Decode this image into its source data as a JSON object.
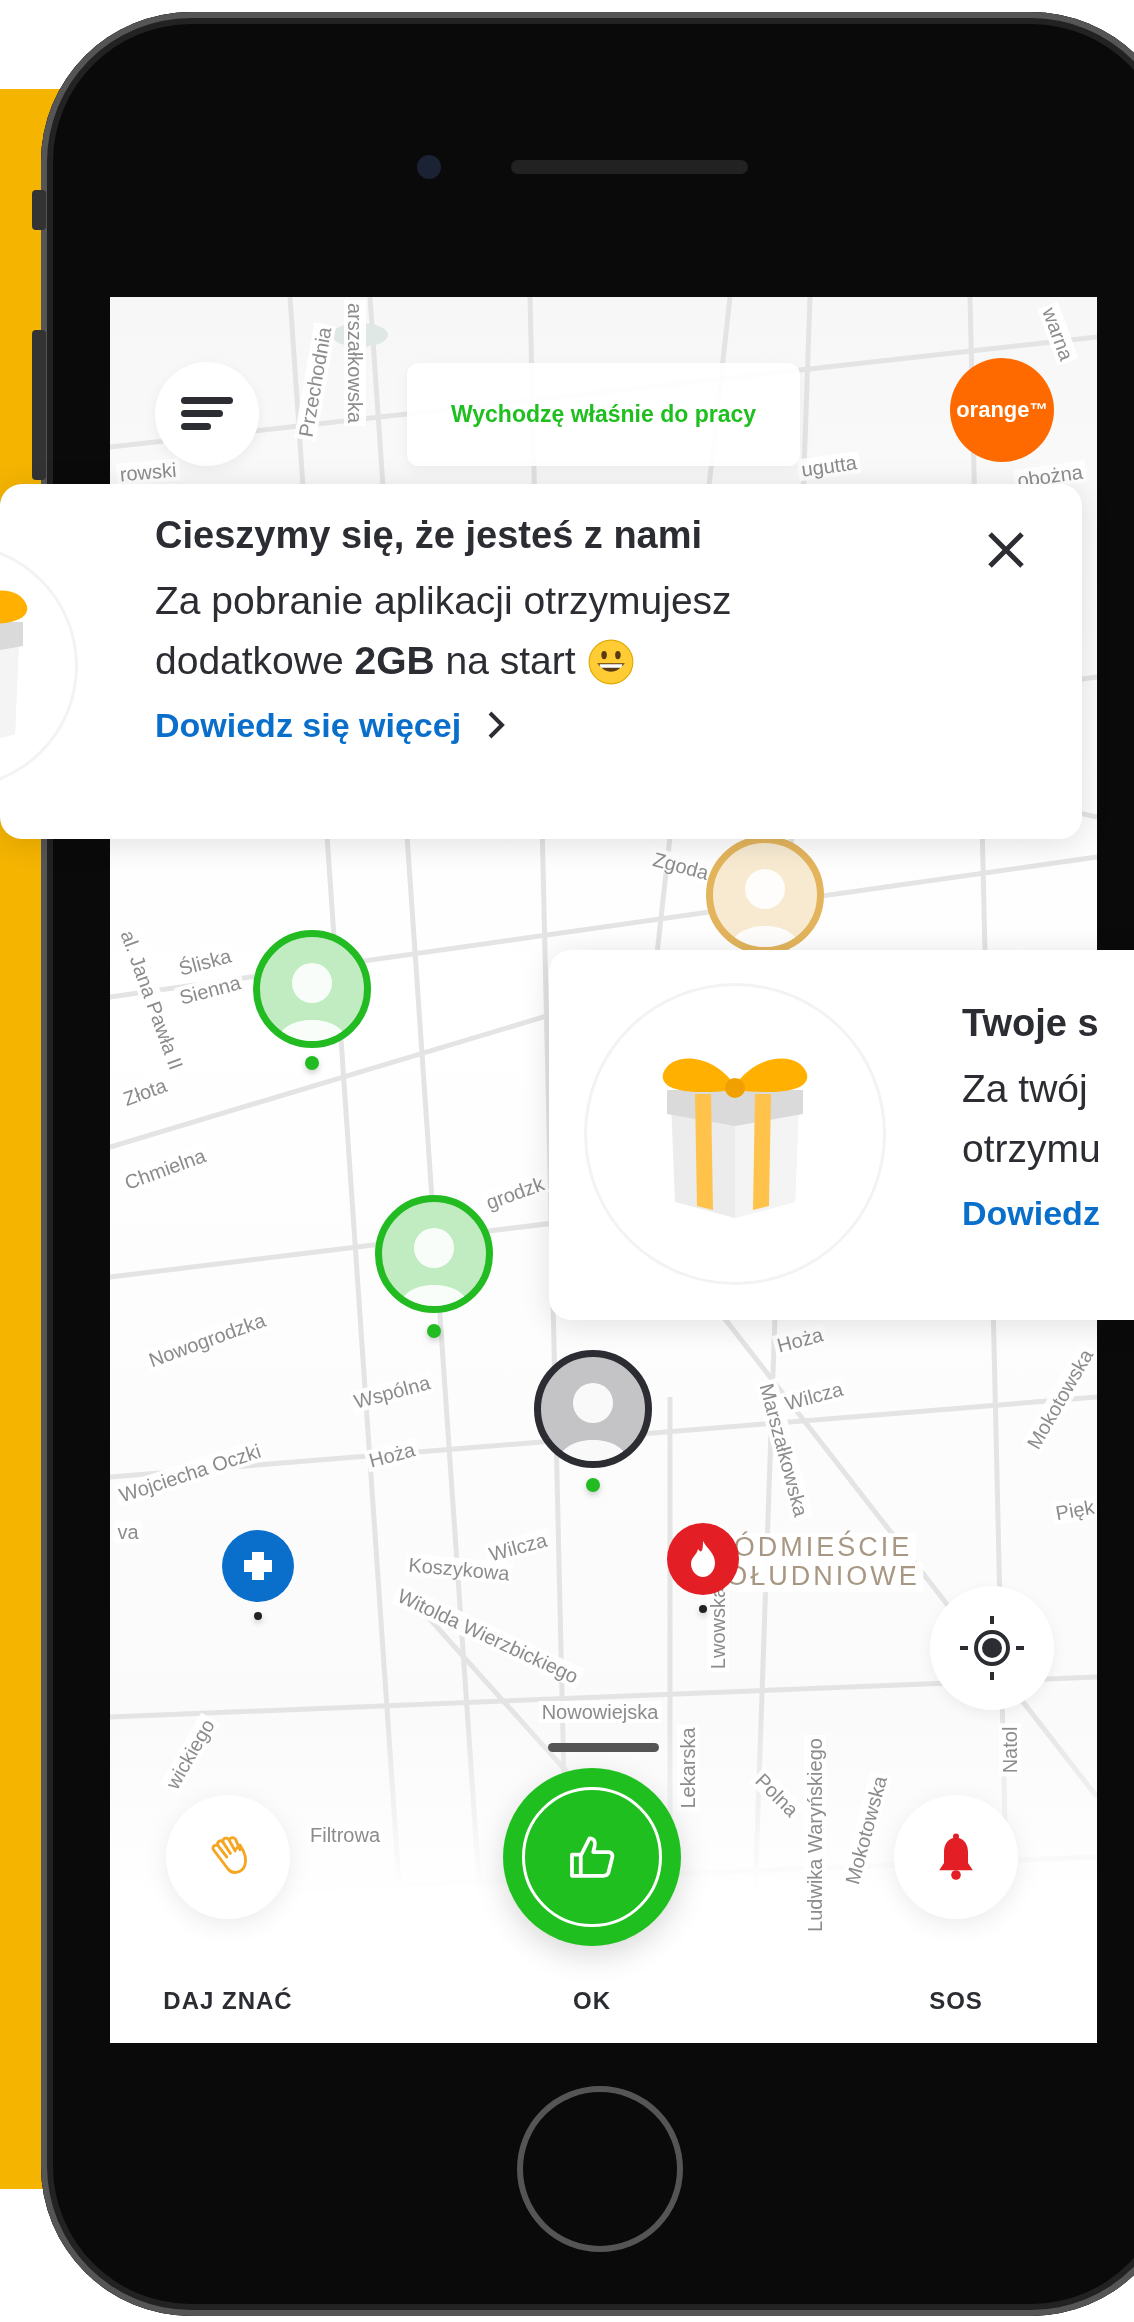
{
  "top_bar": {
    "status": "Wychodzę właśnie do pracy",
    "brand": "orange",
    "brand_mark": "™"
  },
  "cards": [
    {
      "title": "Cieszymy się, że jesteś z nami",
      "body": [
        "Za pobranie aplikacji otrzymujesz",
        "dodatkowe **2GB** na start"
      ],
      "emoji": true,
      "link": "Dowiedz się więcej",
      "closable": true
    },
    {
      "title": "Twoje s",
      "body": [
        "Za twój",
        "otrzymu"
      ],
      "emoji": false,
      "link": "Dowiedz",
      "closable": false
    }
  ],
  "map": {
    "labels": [
      "Przechodnia",
      "arszałkowska",
      "rowski",
      "warna",
      "ugutta",
      "obożna",
      "Zgoda",
      "Śliska",
      "Sienna",
      "al. Jana Pawła II",
      "Złota",
      "Chmielna",
      "Nowogrodzka",
      "grodzk",
      "Wspólna",
      "Wojciecha Oczki",
      "Hoża",
      "Hoża",
      "Wilcza",
      "Wilcza",
      "Koszykowa",
      "Witolda Wierzbickiego",
      "Lwowska",
      "Marszałkowska",
      "Mokotowska",
      "Pięk",
      "ÓDMIEŚCIE",
      "OŁUDNIOWE",
      "Nowowiejska",
      "Lekarska",
      "Filtrowa",
      "wickiego",
      "Polna",
      "Ludwika Waryńskiego",
      "Mokotowska",
      "Natol",
      "va"
    ],
    "avatars": [
      {
        "color": "#22bb22",
        "dot": true
      },
      {
        "color": "#22bb22",
        "dot": true
      },
      {
        "color": "#2b2d33",
        "dot": true
      },
      {
        "color": "#e3b45c",
        "dot": false
      }
    ],
    "pins": [
      {
        "kind": "medical"
      },
      {
        "kind": "fire"
      }
    ]
  },
  "actions": [
    {
      "kind": "wave",
      "label": "DAJ ZNAĆ"
    },
    {
      "kind": "ok",
      "label": "OK"
    },
    {
      "kind": "sos",
      "label": "SOS"
    }
  ]
}
